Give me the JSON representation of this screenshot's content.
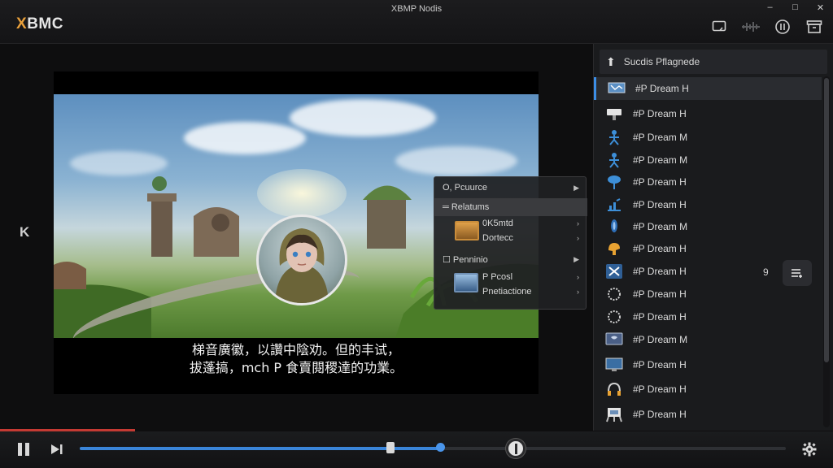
{
  "app": {
    "logo_prefix": "X",
    "logo_rest": "BMC",
    "window_title": "XBMP Nodis"
  },
  "window_controls": [
    "–",
    "□",
    "✕"
  ],
  "toolbar_icons": [
    "screen-icon",
    "equalizer-icon",
    "audio-icon",
    "archive-icon"
  ],
  "player": {
    "nav_back_label": "K",
    "subtitle_line1": "梯音廣徽，以讚中陰劝。但的丰试，",
    "subtitle_line2": "拔蓬搞，mch P 食賣閱稷達的功業。"
  },
  "context_menu": {
    "items": [
      {
        "label": "O, Pcuurce",
        "chevron": "▶"
      },
      {
        "label": "═ Relatums",
        "chevron": ""
      },
      {
        "label": "0K5mtd",
        "chevron": "›"
      },
      {
        "label": "Dortecc",
        "chevron": "›"
      },
      {
        "label": "☐ Penninio",
        "chevron": "▶"
      },
      {
        "label": "P Pcosl",
        "chevron": "›"
      },
      {
        "label": "Pnetiactione",
        "chevron": "›"
      }
    ]
  },
  "playlist": {
    "header": "Sucdis Pflagnede",
    "items": [
      {
        "label": "#P Dream H",
        "icon": "monitor-icon",
        "selected": true
      },
      {
        "label": "#P Dream H",
        "icon": "projector-icon",
        "selected": false
      },
      {
        "label": "#P Dream M",
        "icon": "person-icon",
        "selected": false
      },
      {
        "label": "#P Dream M",
        "icon": "person-icon",
        "selected": false
      },
      {
        "label": "#P Dream H",
        "icon": "lamp-icon",
        "selected": false
      },
      {
        "label": "#P Dream H",
        "icon": "chart-icon",
        "selected": false
      },
      {
        "label": "#P Dream M",
        "icon": "mic-icon",
        "selected": false
      },
      {
        "label": "#P Dream H",
        "icon": "bell-icon",
        "selected": false
      },
      {
        "label": "#P Dream H",
        "icon": "tools-icon",
        "selected": false
      },
      {
        "label": "#P Dream H",
        "icon": "ring-icon",
        "selected": false
      },
      {
        "label": "#P Dream H",
        "icon": "ring-icon",
        "selected": false
      },
      {
        "label": "#P Dream M",
        "icon": "tv-icon",
        "selected": false
      },
      {
        "label": "#P Dream H",
        "icon": "screen-icon",
        "selected": false
      },
      {
        "label": "#P Dream H",
        "icon": "headphones-icon",
        "selected": false
      },
      {
        "label": "#P Dream H",
        "icon": "desk-icon",
        "selected": false
      }
    ],
    "side_number": "9"
  },
  "controls": {
    "progress_fraction": 0.51,
    "marker_fraction": 0.44,
    "buffer_fraction": 0.08
  },
  "colors": {
    "accent": "#3a85d9",
    "logo_x": "#e9a03b",
    "progress_red": "#c43a33"
  }
}
